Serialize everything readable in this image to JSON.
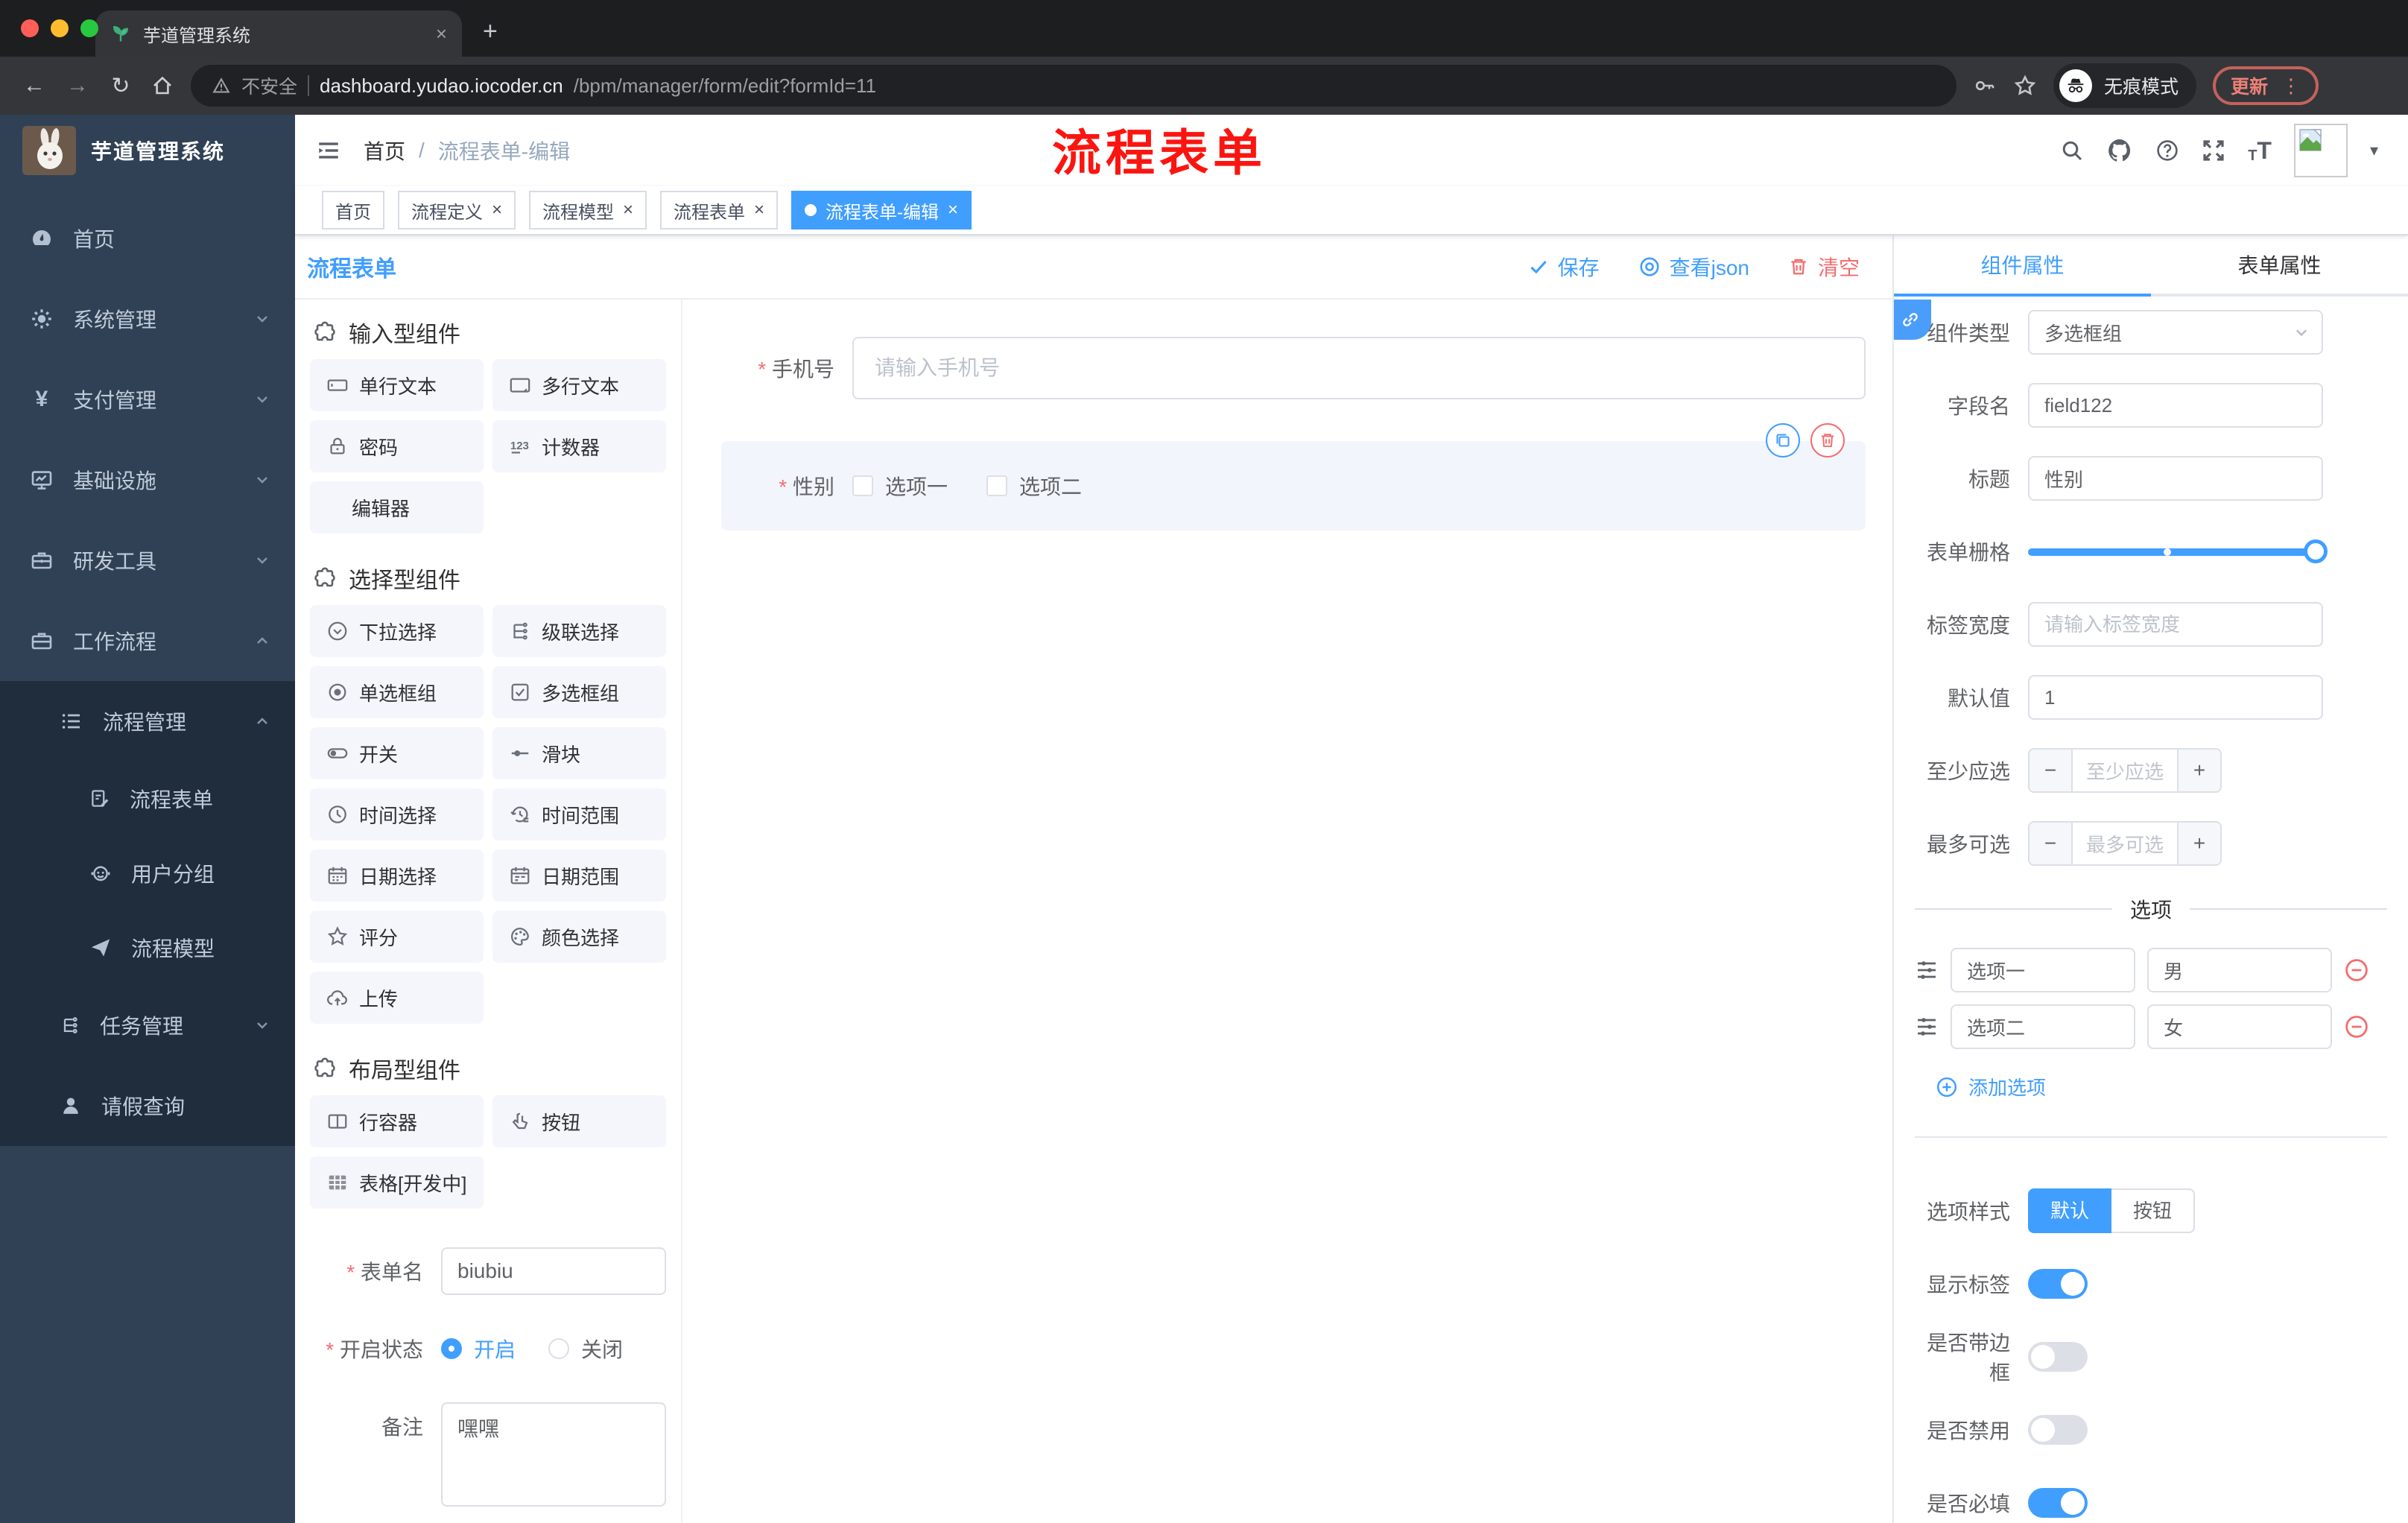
{
  "browser": {
    "tab_title": "芋道管理系统",
    "security_label": "不安全",
    "url_host": "dashboard.yudao.iocoder.cn",
    "url_path": "/bpm/manager/form/edit?formId=11",
    "incognito_label": "无痕模式",
    "update_label": "更新"
  },
  "annotation": {
    "text": "流程表单"
  },
  "sidebar": {
    "brand": "芋道管理系统",
    "items": [
      {
        "label": "首页"
      },
      {
        "label": "系统管理"
      },
      {
        "label": "支付管理"
      },
      {
        "label": "基础设施"
      },
      {
        "label": "研发工具"
      },
      {
        "label": "工作流程"
      }
    ],
    "submenu": {
      "process": {
        "label": "流程管理"
      },
      "children": [
        {
          "label": "流程表单"
        },
        {
          "label": "用户分组"
        },
        {
          "label": "流程模型"
        }
      ],
      "task": {
        "label": "任务管理"
      },
      "leave": {
        "label": "请假查询"
      }
    }
  },
  "header": {
    "breadcrumb_home": "首页",
    "breadcrumb_sep": "/",
    "breadcrumb_current": "流程表单-编辑"
  },
  "tags": {
    "items": [
      {
        "label": "首页"
      },
      {
        "label": "流程定义"
      },
      {
        "label": "流程模型"
      },
      {
        "label": "流程表单"
      },
      {
        "label": "流程表单-编辑"
      }
    ]
  },
  "designer": {
    "title": "流程表单",
    "save_label": "保存",
    "view_json_label": "查看json",
    "clear_label": "清空"
  },
  "palette": {
    "sections": [
      {
        "title": "输入型组件",
        "items": [
          {
            "label": "单行文本"
          },
          {
            "label": "多行文本"
          },
          {
            "label": "密码"
          },
          {
            "label": "计数器"
          },
          {
            "label": "编辑器"
          }
        ]
      },
      {
        "title": "选择型组件",
        "items": [
          {
            "label": "下拉选择"
          },
          {
            "label": "级联选择"
          },
          {
            "label": "单选框组"
          },
          {
            "label": "多选框组"
          },
          {
            "label": "开关"
          },
          {
            "label": "滑块"
          },
          {
            "label": "时间选择"
          },
          {
            "label": "时间范围"
          },
          {
            "label": "日期选择"
          },
          {
            "label": "日期范围"
          },
          {
            "label": "评分"
          },
          {
            "label": "颜色选择"
          },
          {
            "label": "上传"
          }
        ]
      },
      {
        "title": "布局型组件",
        "items": [
          {
            "label": "行容器"
          },
          {
            "label": "按钮"
          },
          {
            "label": "表格[开发中]"
          }
        ]
      }
    ]
  },
  "form_info": {
    "name_label": "表单名",
    "name_value": "biubiu",
    "status_label": "开启状态",
    "status_on": "开启",
    "status_off": "关闭",
    "remark_label": "备注",
    "remark_value": "嘿嘿"
  },
  "canvas": {
    "phone_label": "手机号",
    "phone_placeholder": "请输入手机号",
    "gender_label": "性别",
    "gender_option1": "选项一",
    "gender_option2": "选项二"
  },
  "props": {
    "tab_component": "组件属性",
    "tab_form": "表单属性",
    "type_label": "组件类型",
    "type_value": "多选框组",
    "field_label": "字段名",
    "field_value": "field122",
    "title_label": "标题",
    "title_value": "性别",
    "grid_label": "表单栅格",
    "label_width_label": "标签宽度",
    "label_width_placeholder": "请输入标签宽度",
    "default_label": "默认值",
    "default_value": "1",
    "min_label": "至少应选",
    "min_placeholder": "至少应选",
    "max_label": "最多可选",
    "max_placeholder": "最多可选",
    "options_title": "选项",
    "options": [
      {
        "label": "选项一",
        "value": "男"
      },
      {
        "label": "选项二",
        "value": "女"
      }
    ],
    "add_option_label": "添加选项",
    "style_label": "选项样式",
    "style_default": "默认",
    "style_button": "按钮",
    "show_label_label": "显示标签",
    "bordered_label": "是否带边框",
    "disabled_label": "是否禁用",
    "required_label": "是否必填"
  },
  "icons": {
    "close": "×",
    "new_tab": "+",
    "back": "←",
    "forward": "→",
    "reload": "↻",
    "dots_vertical": "⋮",
    "caret_down": "▾",
    "minus": "−",
    "plus": "+"
  },
  "colors": {
    "accent": "#409eff",
    "danger": "#f56c6c",
    "sidebar_bg": "#304156",
    "submenu_bg": "#1f2d3d",
    "annotation_red": "#fb1510"
  }
}
